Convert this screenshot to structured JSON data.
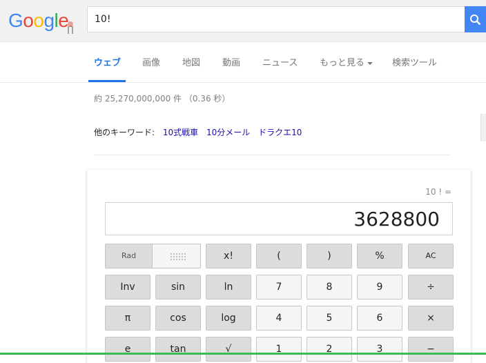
{
  "header": {
    "logo_letters": [
      {
        "ch": "G",
        "color": "#4285f4"
      },
      {
        "ch": "o",
        "color": "#ea4335"
      },
      {
        "ch": "o",
        "color": "#fbbc05"
      },
      {
        "ch": "g",
        "color": "#4285f4"
      },
      {
        "ch": "l",
        "color": "#34a853"
      },
      {
        "ch": "e",
        "color": "#ea4335"
      }
    ],
    "search_value": "10!",
    "search_icon": "search-icon",
    "accent": "#4285f4"
  },
  "nav": {
    "tabs": [
      "ウェブ",
      "画像",
      "地図",
      "動画",
      "ニュース",
      "もっと見る",
      "検索ツール"
    ],
    "active_color": "#1a73e8"
  },
  "result_stats": "約 25,270,000,000 件 （0.36 秒）",
  "related": {
    "label": "他のキーワード:",
    "links": [
      "10式戦車",
      "10分メール",
      "ドラクエ10"
    ]
  },
  "calculator": {
    "expression": "10 ! =",
    "display_value": "3628800",
    "mode_label": "Rad",
    "keys": [
      [
        "x!",
        "(",
        ")",
        "%",
        "AC"
      ],
      [
        "Inv",
        "sin",
        "ln",
        "7",
        "8",
        "9",
        "÷"
      ],
      [
        "π",
        "cos",
        "log",
        "4",
        "5",
        "6",
        "×"
      ],
      [
        "e",
        "tan",
        "√",
        "1",
        "2",
        "3",
        "−"
      ]
    ]
  }
}
